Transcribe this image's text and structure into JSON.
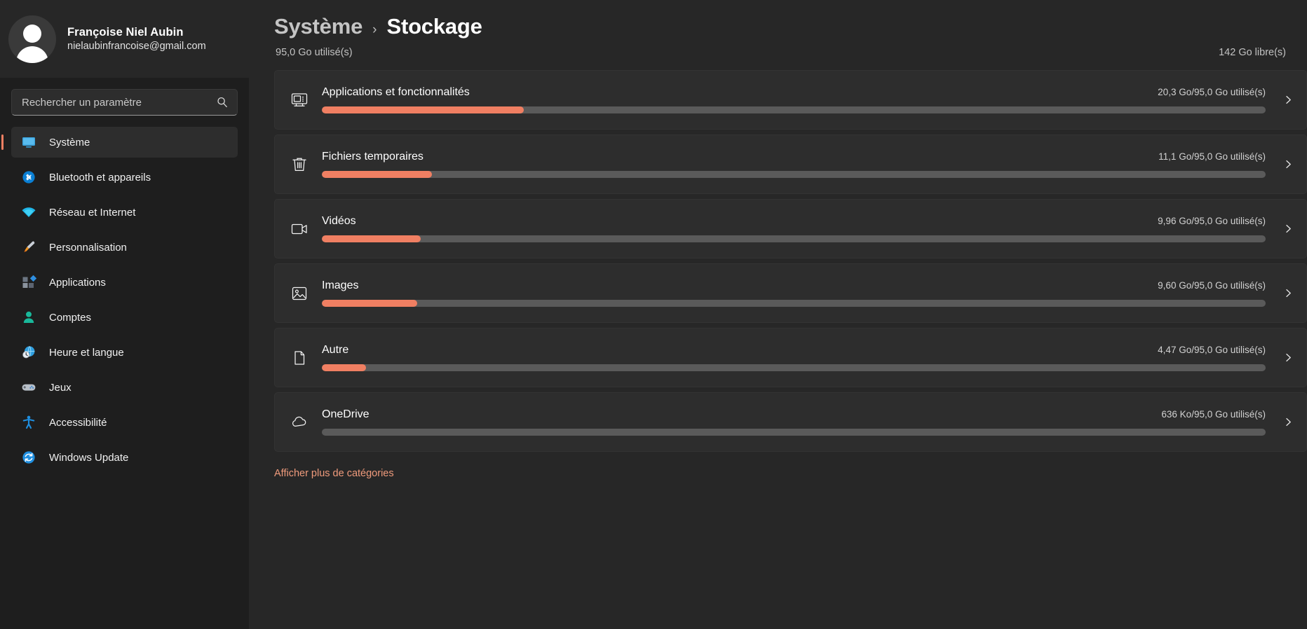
{
  "sidebar": {
    "profile": {
      "name": "Françoise Niel Aubin",
      "email": "nielaubinfrancoise@gmail.com",
      "avatar_icon": "user-avatar-icon"
    },
    "search": {
      "placeholder": "Rechercher un paramètre",
      "value": "",
      "icon": "search-icon"
    },
    "items": [
      {
        "label": "Système",
        "icon": "monitor-icon",
        "selected": true
      },
      {
        "label": "Bluetooth et appareils",
        "icon": "bluetooth-icon",
        "selected": false
      },
      {
        "label": "Réseau et Internet",
        "icon": "wifi-icon",
        "selected": false
      },
      {
        "label": "Personnalisation",
        "icon": "paintbrush-icon",
        "selected": false
      },
      {
        "label": "Applications",
        "icon": "apps-icon",
        "selected": false
      },
      {
        "label": "Comptes",
        "icon": "person-icon",
        "selected": false
      },
      {
        "label": "Heure et langue",
        "icon": "clock-globe-icon",
        "selected": false
      },
      {
        "label": "Jeux",
        "icon": "gamepad-icon",
        "selected": false
      },
      {
        "label": "Accessibilité",
        "icon": "accessibility-icon",
        "selected": false
      },
      {
        "label": "Windows Update",
        "icon": "update-refresh-icon",
        "selected": false
      }
    ]
  },
  "header": {
    "breadcrumb_parent": "Système",
    "breadcrumb_separator": "›",
    "breadcrumb_current": "Stockage",
    "used_summary": "95,0 Go utilisé(s)",
    "free_summary": "142 Go libre(s)"
  },
  "storage": {
    "rows": [
      {
        "title": "Applications et fonctionnalités",
        "usage": "20,3 Go/95,0 Go utilisé(s)",
        "percent": 21.4,
        "icon": "apps-features-icon",
        "chevron": "chevron-right-icon"
      },
      {
        "title": "Fichiers temporaires",
        "usage": "11,1 Go/95,0 Go utilisé(s)",
        "percent": 11.7,
        "icon": "trash-icon",
        "chevron": "chevron-right-icon"
      },
      {
        "title": "Vidéos",
        "usage": "9,96 Go/95,0 Go utilisé(s)",
        "percent": 10.5,
        "icon": "video-camera-icon",
        "chevron": "chevron-right-icon"
      },
      {
        "title": "Images",
        "usage": "9,60 Go/95,0 Go utilisé(s)",
        "percent": 10.1,
        "icon": "picture-icon",
        "chevron": "chevron-right-icon"
      },
      {
        "title": "Autre",
        "usage": "4,47 Go/95,0 Go utilisé(s)",
        "percent": 4.7,
        "icon": "document-icon",
        "chevron": "chevron-right-icon"
      },
      {
        "title": "OneDrive",
        "usage": "636 Ko/95,0 Go utilisé(s)",
        "percent": 0,
        "icon": "cloud-icon",
        "chevron": "chevron-right-icon"
      }
    ],
    "more_link": "Afficher plus de catégories"
  },
  "colors": {
    "accent": "#f07f62",
    "link": "#f09b7c",
    "bar_track": "#5a5a5a",
    "sidebar_bg": "#1e1e1e",
    "main_bg": "#272727",
    "card_bg": "#2d2d2d"
  }
}
